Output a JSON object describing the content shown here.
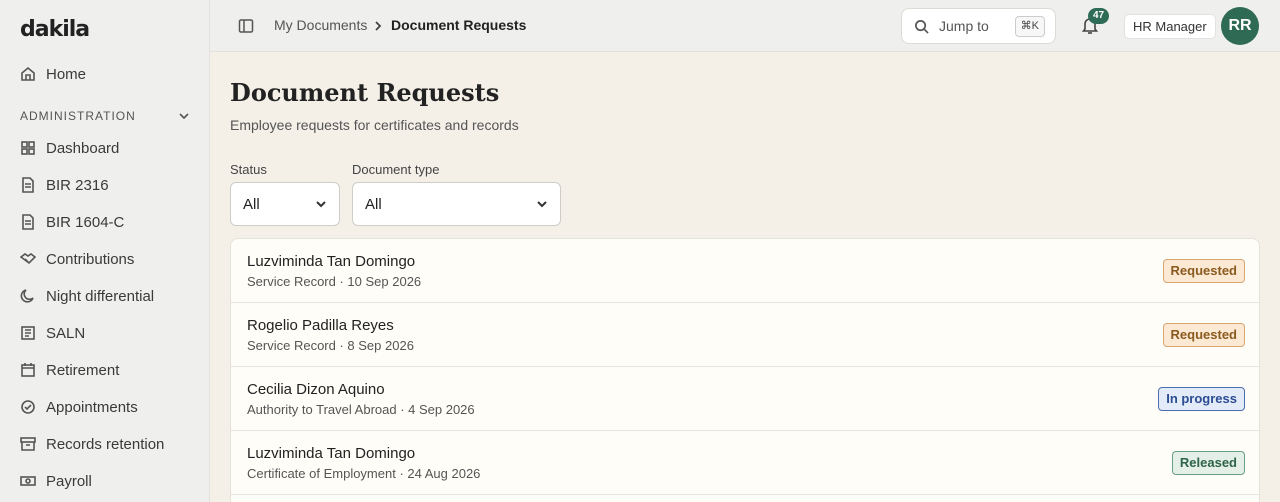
{
  "app": {
    "logo": "dakila"
  },
  "sidebar": {
    "home": "Home",
    "section": "ADMINISTRATION",
    "items": [
      {
        "label": "Dashboard",
        "icon": "grid-icon"
      },
      {
        "label": "BIR 2316",
        "icon": "file-icon"
      },
      {
        "label": "BIR 1604-C",
        "icon": "file-icon"
      },
      {
        "label": "Contributions",
        "icon": "handshake-icon"
      },
      {
        "label": "Night differential",
        "icon": "moon-icon"
      },
      {
        "label": "SALN",
        "icon": "ledger-icon"
      },
      {
        "label": "Retirement",
        "icon": "calendar-icon"
      },
      {
        "label": "Appointments",
        "icon": "check-circle-icon"
      },
      {
        "label": "Records retention",
        "icon": "archive-icon"
      },
      {
        "label": "Payroll",
        "icon": "banknote-icon"
      }
    ]
  },
  "header": {
    "breadcrumb": [
      "My Documents",
      "Document Requests"
    ],
    "jump_placeholder": "Jump to",
    "jump_shortcut": "⌘K",
    "notification_count": "47",
    "role": "HR Manager",
    "avatar_initials": "RR"
  },
  "main": {
    "title": "Document Requests",
    "subtitle": "Employee requests for certificates and records",
    "filters": {
      "status_label": "Status",
      "status_value": "All",
      "type_label": "Document type",
      "type_value": "All"
    },
    "requests": [
      {
        "name": "Luzviminda Tan Domingo",
        "meta": "Service Record · 10 Sep 2026",
        "status": "Requested",
        "status_kind": "requested"
      },
      {
        "name": "Rogelio Padilla Reyes",
        "meta": "Service Record · 8 Sep 2026",
        "status": "Requested",
        "status_kind": "requested"
      },
      {
        "name": "Cecilia Dizon Aquino",
        "meta": "Authority to Travel Abroad · 4 Sep 2026",
        "status": "In progress",
        "status_kind": "progress"
      },
      {
        "name": "Luzviminda Tan Domingo",
        "meta": "Certificate of Employment · 24 Aug 2026",
        "status": "Released",
        "status_kind": "released"
      }
    ]
  }
}
